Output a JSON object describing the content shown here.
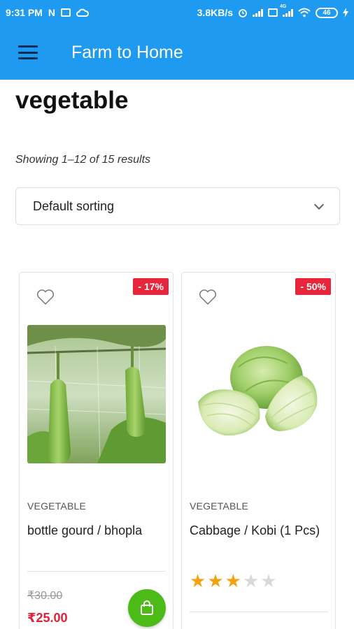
{
  "status_bar": {
    "time": "9:31 PM",
    "network_speed": "3.8KB/s",
    "battery": "46",
    "network_type": "4G",
    "icons": [
      "notification-n-icon",
      "message-icon",
      "cloud-icon",
      "alarm-icon",
      "signal-icon",
      "volte-icon",
      "wifi-icon",
      "battery-icon",
      "charging-icon"
    ]
  },
  "app_bar": {
    "title": "Farm to Home",
    "menu_icon": "hamburger-menu-icon"
  },
  "page": {
    "title": "vegetable",
    "result_count": "Showing 1–12 of 15 results",
    "sorting": {
      "selected": "Default sorting"
    }
  },
  "products": [
    {
      "discount": "- 17%",
      "category": "VEGETABLE",
      "name": "bottle gourd / bhopla",
      "old_price": "₹30.00",
      "price": "₹25.00",
      "cart_icon": "shopping-bag-icon",
      "wishlist_icon": "heart-icon"
    },
    {
      "discount": "- 50%",
      "category": "VEGETABLE",
      "name": "Cabbage / Kobi (1 Pcs)",
      "rating": 3,
      "rating_max": 5,
      "wishlist_icon": "heart-icon"
    }
  ],
  "colors": {
    "primary": "#1e9bf0",
    "sale_badge": "#e8263b",
    "price": "#e0203a",
    "cart_button": "#4cbb17",
    "star": "#f3a214"
  }
}
